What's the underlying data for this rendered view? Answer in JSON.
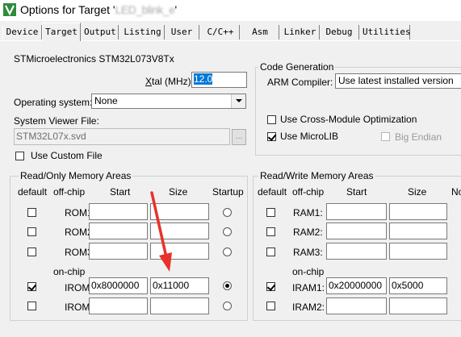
{
  "window": {
    "title_prefix": "Options for Target '",
    "title_blurred": "LED_blink_e",
    "title_suffix": "'"
  },
  "tabs": [
    {
      "label": "Device"
    },
    {
      "label": "Target"
    },
    {
      "label": "Output"
    },
    {
      "label": "Listing"
    },
    {
      "label": "User"
    },
    {
      "label": "C/C++"
    },
    {
      "label": "Asm"
    },
    {
      "label": "Linker"
    },
    {
      "label": "Debug"
    },
    {
      "label": "Utilities"
    }
  ],
  "target": {
    "device_name": "STMicroelectronics STM32L073V8Tx",
    "xtal_label_x": "X",
    "xtal_label_rest": "tal (MHz):",
    "xtal_value": "12.0",
    "os_label": "Operating system:",
    "os_value": "None",
    "svd_label": "System Viewer File:",
    "svd_value": "STM32L07x.svd",
    "browse_label": "...",
    "custom_file_label": "Use Custom File"
  },
  "code_generation": {
    "title": "Code Generation",
    "compiler_label": "ARM Compiler:",
    "compiler_value": "Use latest installed version",
    "cross_module_label": "Use Cross-Module Optimization",
    "microlib_label": "Use MicroLIB",
    "big_endian_label": "Big Endian"
  },
  "rom_areas": {
    "title": "Read/Only Memory Areas",
    "headers": {
      "default": "default",
      "offchip": "off-chip",
      "start": "Start",
      "size": "Size",
      "startup": "Startup"
    },
    "onchip_label": "on-chip",
    "rows": [
      {
        "label": "ROM1:",
        "start": "",
        "size": "",
        "default": false,
        "startup": false
      },
      {
        "label": "ROM2:",
        "start": "",
        "size": "",
        "default": false,
        "startup": false
      },
      {
        "label": "ROM3:",
        "start": "",
        "size": "",
        "default": false,
        "startup": false
      },
      {
        "label": "IROM1:",
        "start": "0x8000000",
        "size": "0x11000",
        "default": true,
        "startup": true
      },
      {
        "label": "IROM2:",
        "start": "",
        "size": "",
        "default": false,
        "startup": false
      }
    ]
  },
  "ram_areas": {
    "title": "Read/Write Memory Areas",
    "headers": {
      "default": "default",
      "offchip": "off-chip",
      "start": "Start",
      "size": "Size",
      "noinit": "No"
    },
    "onchip_label": "on-chip",
    "rows": [
      {
        "label": "RAM1:",
        "start": "",
        "size": "",
        "default": false
      },
      {
        "label": "RAM2:",
        "start": "",
        "size": "",
        "default": false
      },
      {
        "label": "RAM3:",
        "start": "",
        "size": "",
        "default": false
      },
      {
        "label": "IRAM1:",
        "start": "0x20000000",
        "size": "0x5000",
        "default": true
      },
      {
        "label": "IRAM2:",
        "start": "",
        "size": "",
        "default": false
      }
    ]
  },
  "annotation": {
    "arrow_color": "#e8312a"
  },
  "colors": {
    "selection": "#0078d7",
    "icon_green": "#2e8b3a"
  }
}
